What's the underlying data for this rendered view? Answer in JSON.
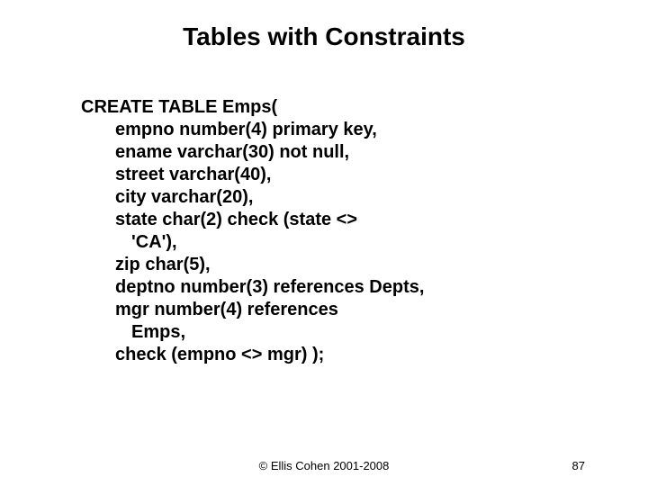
{
  "title": "Tables with Constraints",
  "code": {
    "l1": "CREATE TABLE Emps(",
    "l2": "empno  number(4)  primary key,",
    "l3": "ename  varchar(30)  not null,",
    "l4": "street             varchar(40),",
    "l5": "city                 varchar(20),",
    "l6": "state               char(2)  check (state <>",
    "l7": "'CA'),",
    "l8": "zip                  char(5),",
    "l9": "deptno number(3)  references Depts,",
    "l10": "mgr                number(4)  references",
    "l11": "Emps,",
    "l12": "check (empno <> mgr) );"
  },
  "footer": {
    "copyright": "© Ellis Cohen 2001-2008",
    "page": "87"
  }
}
